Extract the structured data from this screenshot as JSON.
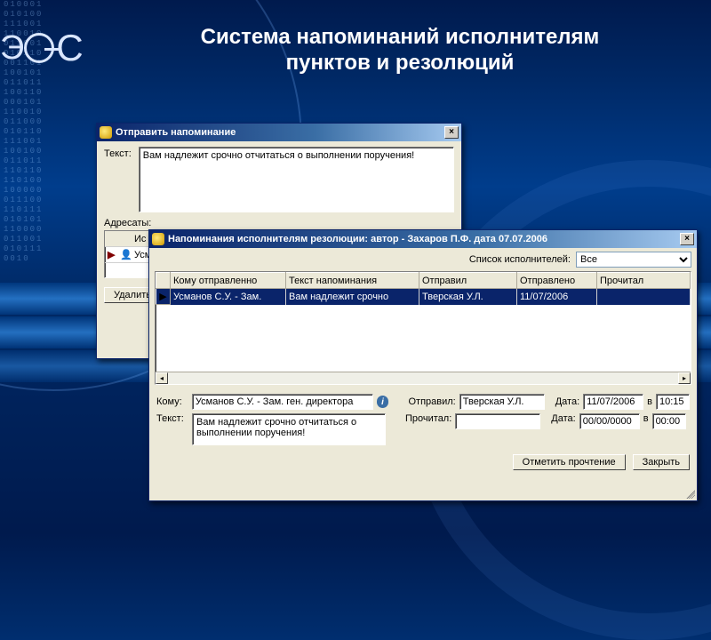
{
  "slide": {
    "title": "Система напоминаний исполнителям пунктов и резолюций",
    "logo_text": "ЭОС",
    "binary_pattern": "0100010101001110011100100110010101100011011001010110111001100001011100100110000101101110011001000110111101101101001000000111001101110101011100000110010101110010"
  },
  "dialog1": {
    "title": "Отправить напоминание",
    "text_label": "Текст:",
    "text_value": "Вам надлежит срочно отчитаться о выполнении поручения!",
    "addresses_label": "Адресаты:",
    "addr_col_header": "Ис",
    "addr_row_name": "Усм",
    "delete_button": "Удалить"
  },
  "dialog2": {
    "title": "Напоминания исполнителям резолюции: автор - Захаров П.Ф. дата 07.07.2006",
    "filter_label": "Список исполнителей:",
    "filter_value": "Все",
    "columns": {
      "to": "Кому отправленно",
      "text": "Текст напоминания",
      "sent_by": "Отправил",
      "sent_at": "Отправлено",
      "read_at": "Прочитал"
    },
    "rows": [
      {
        "to": "Усманов С.У. - Зам.",
        "text": "Вам надлежит срочно",
        "sent_by": "Тверская У.Л.",
        "sent_at": "11/07/2006",
        "read_at": ""
      }
    ],
    "details": {
      "to_label": "Кому:",
      "to_value": "Усманов С.У. - Зам. ген. директора",
      "sent_by_label": "Отправил:",
      "sent_by_value": "Тверская У.Л.",
      "date_label": "Дата:",
      "time_label": "в",
      "sent_date": "11/07/2006",
      "sent_time": "10:15",
      "text_label": "Текст:",
      "text_value": "Вам надлежит срочно отчитаться о выполнении поручения!",
      "read_by_label": "Прочитал:",
      "read_by_value": "",
      "read_date": "00/00/0000",
      "read_time": "00:00"
    },
    "buttons": {
      "mark_read": "Отметить прочтение",
      "close": "Закрыть"
    }
  }
}
